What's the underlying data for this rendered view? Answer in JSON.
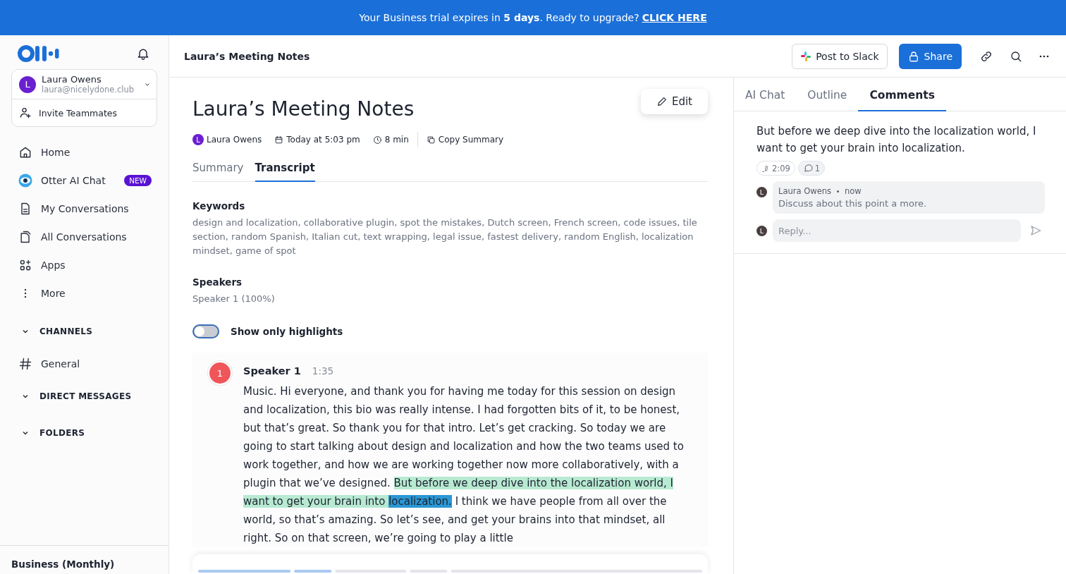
{
  "banner": {
    "text": "Your Business trial expires in **5 days**. Ready to upgrade?",
    "link": "CLICK HERE"
  },
  "sidebar": {
    "account": {
      "initial": "L",
      "name": "Laura Owens",
      "email": "laura@nicelydone.club"
    },
    "invite": "Invite Teammates",
    "items": [
      {
        "kind": "home",
        "label": "Home"
      },
      {
        "kind": "chat",
        "label": "Otter AI Chat",
        "badge": "NEW"
      },
      {
        "kind": "mine",
        "label": "My Conversations"
      },
      {
        "kind": "all",
        "label": "All Conversations"
      },
      {
        "kind": "apps",
        "label": "Apps"
      },
      {
        "kind": "more",
        "label": "More"
      }
    ],
    "sections": [
      {
        "title": "CHANNELS",
        "expanded": true,
        "items": [
          {
            "label": "General"
          }
        ]
      },
      {
        "title": "DIRECT MESSAGES",
        "expanded": true
      },
      {
        "title": "FOLDERS",
        "expanded": true
      }
    ],
    "plan": "Business (Monthly)"
  },
  "header": {
    "title": "Laura’s Meeting Notes",
    "slack": "Post to Slack",
    "share": "Share"
  },
  "note": {
    "title": "Laura’s Meeting Notes",
    "edit": "Edit",
    "author_initial": "L",
    "author": "Laura Owens",
    "date": "Today at 5:03 pm",
    "duration": "8 min",
    "copy": "Copy Summary",
    "tabs": [
      {
        "label": "Summary",
        "selected": false
      },
      {
        "label": "Transcript",
        "selected": true
      }
    ],
    "keywords_heading": "Keywords",
    "keywords": "design and localization, collaborative plugin, spot the mistakes, Dutch screen, French screen, code issues, tile section, random Spanish, Italian cut, text wrapping, legal issue, fastest delivery, random English, localization mindset, game of spot",
    "speakers_heading": "Speakers",
    "speakers": "Speaker 1 (100%)",
    "toggle": {
      "label": "Show only highlights",
      "on": false
    },
    "transcript": {
      "number": "1",
      "speaker": "Speaker 1",
      "time": "1:35",
      "segments": [
        {
          "kind": "plain",
          "text": "Music. Hi everyone, and thank you for having me today for this session on design and localization, this bio was really intense. I had forgotten bits of it, to be honest, but that’s great. So thank you for that intro. Let’s get cracking. So today we are going to start talking about design and localization and how the two teams used to work together, and how we are working together now more collaboratively, with a plugin that we’ve designed. "
        },
        {
          "kind": "highlight",
          "text": "But before we deep dive into the localization world, I want to get your brain into "
        },
        {
          "kind": "active",
          "text": "localization."
        },
        {
          "kind": "plain",
          "text": " I think we have people from all over the world, so that’s amazing. So let’s see, and get your brains into that mindset, all right. So on that screen, we’re going to play a little"
        }
      ]
    }
  },
  "panel": {
    "tabs": [
      {
        "label": "AI Chat",
        "selected": false
      },
      {
        "label": "Outline",
        "selected": false
      },
      {
        "label": "Comments",
        "selected": true
      }
    ],
    "quote": "But before we deep dive into the localization world, I want to get your brain into localization.",
    "timestamp": "2:09",
    "comment_count": "1",
    "comment": {
      "initial": "L",
      "author": "Laura Owens",
      "time": "now",
      "text": "Discuss about this point a more."
    },
    "reply": {
      "initial": "L",
      "placeholder": "Reply..."
    }
  }
}
